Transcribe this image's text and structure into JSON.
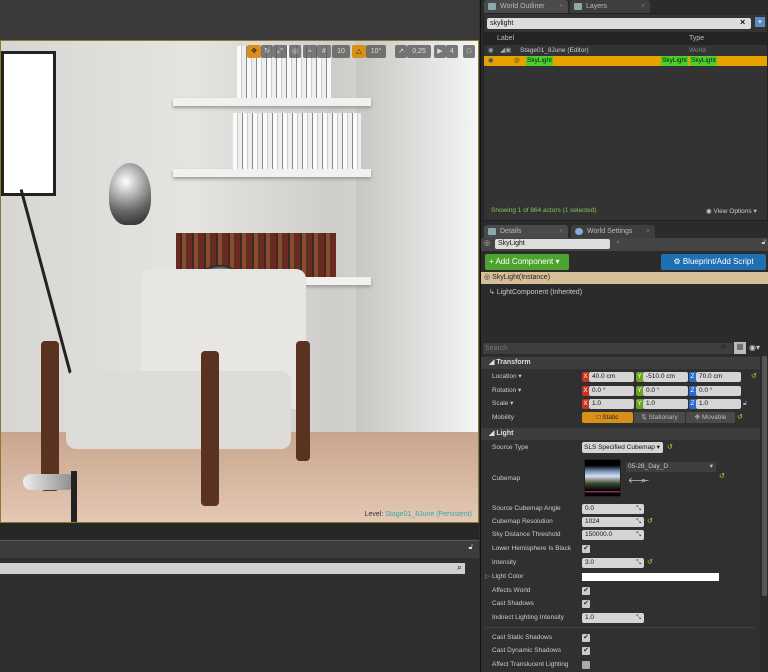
{
  "viewport": {
    "toolbar": {
      "grid_snap": "10",
      "rotate_snap": "10°",
      "scale_snap": "0.25",
      "camera_speed": "4"
    },
    "level_label": "Level:",
    "level_name": "Stage01_8June (Persistent)"
  },
  "outliner": {
    "tabs": [
      "World Outliner",
      "Layers"
    ],
    "search_value": "skylight",
    "col_label": "Label",
    "col_type": "Type",
    "rows": [
      {
        "label": "Stage01_8June (Editor)",
        "type": "World"
      },
      {
        "label": "SkyLight",
        "type": "SkyLight",
        "type2": "SkyLight"
      }
    ],
    "status": "Showing 1 of 864 actors (1 selected)",
    "view_options": "View Options"
  },
  "details": {
    "tabs": [
      "Details",
      "World Settings"
    ],
    "actor_name": "SkyLight",
    "add_component": "+ Add Component",
    "blueprint": "Blueprint/Add Script",
    "components": [
      "SkyLight(Instance)",
      "LightComponent (Inherited)"
    ],
    "search_placeholder": "Search",
    "transform": {
      "title": "Transform",
      "location": {
        "label": "Location",
        "x": "40.0 cm",
        "y": "-510.0 cm",
        "z": "70.0 cm"
      },
      "rotation": {
        "label": "Rotation",
        "x": "0.0 °",
        "y": "0.0 °",
        "z": "0.0 °"
      },
      "scale": {
        "label": "Scale",
        "x": "1.0",
        "y": "1.0",
        "z": "1.0"
      },
      "mobility": {
        "label": "Mobility",
        "options": [
          "Static",
          "Stationary",
          "Movable"
        ],
        "selected": "Static"
      }
    },
    "light": {
      "title": "Light",
      "source_type": {
        "label": "Source Type",
        "value": "SLS Specified Cubemap"
      },
      "cubemap": {
        "label": "Cubemap",
        "value": "05-28_Day_D"
      },
      "source_cubemap_angle": {
        "label": "Source Cubemap Angle",
        "value": "0.0"
      },
      "cubemap_resolution": {
        "label": "Cubemap Resolution",
        "value": "1024"
      },
      "sky_distance_threshold": {
        "label": "Sky Distance Threshold",
        "value": "150000.0"
      },
      "lower_hemisphere_black": {
        "label": "Lower Hemisphere Is Black",
        "checked": true
      },
      "intensity": {
        "label": "Intensity",
        "value": "3.0"
      },
      "light_color": {
        "label": "Light Color",
        "value": "#ffffff"
      },
      "affects_world": {
        "label": "Affects World",
        "checked": true
      },
      "cast_shadows": {
        "label": "Cast Shadows",
        "checked": true
      },
      "indirect_lighting_intensity": {
        "label": "Indirect Lighting Intensity",
        "value": "1.0"
      },
      "cast_static_shadows": {
        "label": "Cast Static Shadows",
        "checked": true
      },
      "cast_dynamic_shadows": {
        "label": "Cast Dynamic Shadows",
        "checked": true
      },
      "affect_translucent_lighting": {
        "label": "Affect Translucent Lighting",
        "checked": false
      }
    }
  },
  "colors": {
    "selection": "#e8a200",
    "add_green": "#4ca32e",
    "blueprint_blue": "#1f6fb3",
    "instance_tan": "#d6bf98"
  }
}
